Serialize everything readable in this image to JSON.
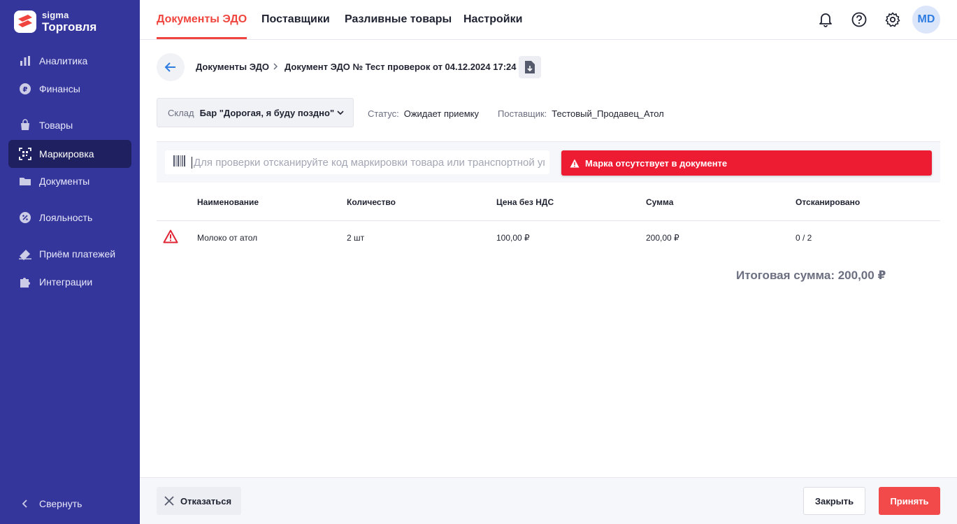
{
  "sidebar": {
    "logo": {
      "sub": "sigma",
      "main": "Торговля"
    },
    "items": [
      {
        "label": "Аналитика",
        "icon": "bar-chart-icon"
      },
      {
        "label": "Финансы",
        "icon": "ruble-coin-icon"
      },
      {
        "label": "Товары",
        "icon": "shopping-bag-icon"
      },
      {
        "label": "Маркировка",
        "icon": "datamatrix-scan-icon",
        "active": true
      },
      {
        "label": "Документы",
        "icon": "folder-icon"
      },
      {
        "label": "Лояльность",
        "icon": "percent-badge-icon"
      },
      {
        "label": "Приём платежей",
        "icon": "payment-icon"
      },
      {
        "label": "Интеграции",
        "icon": "puzzle-icon"
      }
    ],
    "collapse_label": "Свернуть"
  },
  "topbar": {
    "tabs": [
      {
        "label": "Документы ЭДО",
        "active": true
      },
      {
        "label": "Поставщики"
      },
      {
        "label": "Разливные товары"
      },
      {
        "label": "Настройки"
      }
    ],
    "avatar_initials": "MD"
  },
  "breadcrumb": {
    "root": "Документы ЭДО",
    "current": "Документ ЭДО № Тест проверок от 04.12.2024 17:24"
  },
  "warehouse": {
    "label": "Склад",
    "value": "Бар \"Дорогая, я буду поздно\""
  },
  "status": {
    "label": "Статус:",
    "value": "Ожидает приемку"
  },
  "supplier": {
    "label": "Поставщик:",
    "value": "Тестовый_Продавец_Атол"
  },
  "scan": {
    "placeholder": "Для проверки отсканируйте код маркировки товара или транспортной упаковки"
  },
  "alert": {
    "text": "Марка отсутствует в документе"
  },
  "table": {
    "headers": [
      "Наименование",
      "Количество",
      "Цена без НДС",
      "Сумма",
      "Отсканировано"
    ],
    "rows": [
      {
        "name": "Молоко от атол",
        "qty": "2 шт",
        "price": "100,00 ₽",
        "sum": "200,00 ₽",
        "scanned": "0 / 2"
      }
    ]
  },
  "total": "Итоговая сумма: 200,00 ₽",
  "footer": {
    "refuse_label": "Отказаться",
    "close_label": "Закрыть",
    "accept_label": "Принять"
  },
  "colors": {
    "sidebar": "#35369b",
    "accent": "#f0453e",
    "alert": "#ee1c33",
    "accept": "#f24a4a"
  }
}
